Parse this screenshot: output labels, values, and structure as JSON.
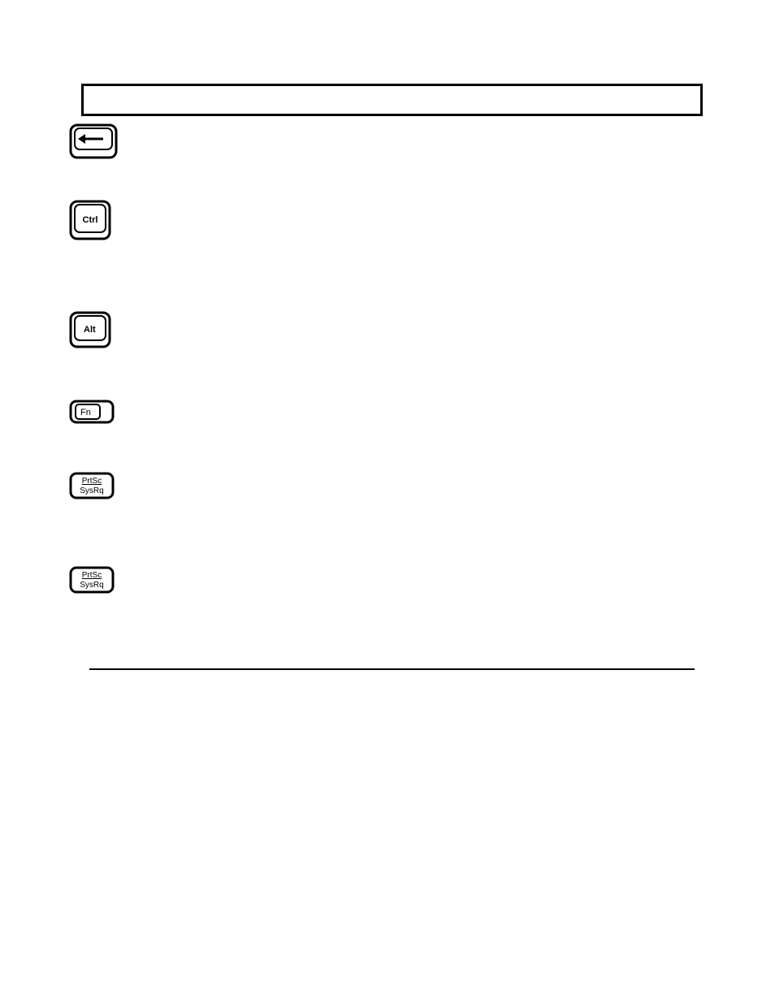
{
  "keys": {
    "backspace": {
      "label": "←"
    },
    "ctrl": {
      "label": "Ctrl"
    },
    "alt": {
      "label": "Alt"
    },
    "fn": {
      "label": "Fn"
    },
    "prtsc1": {
      "label_top": "PrtSc",
      "label_bottom": "SysRq"
    },
    "prtsc2": {
      "label_top": "PrtSc",
      "label_bottom": "SysRq"
    }
  }
}
